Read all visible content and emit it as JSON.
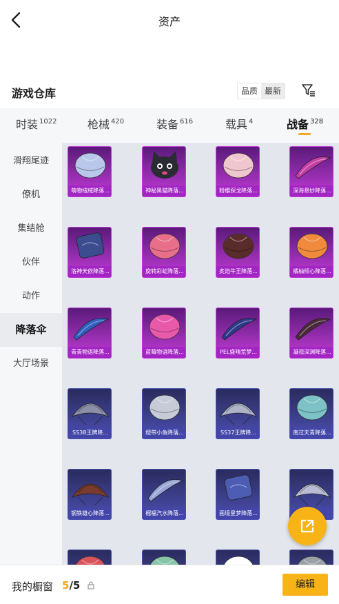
{
  "header": {
    "title": "资产"
  },
  "warehouse": {
    "title": "游戏仓库",
    "sort_options": [
      "品质",
      "最新"
    ],
    "active_sort": "品质"
  },
  "tabs": [
    {
      "label": "时装",
      "count": "1022"
    },
    {
      "label": "枪械",
      "count": "420"
    },
    {
      "label": "装备",
      "count": "616"
    },
    {
      "label": "载具",
      "count": "4"
    },
    {
      "label": "战备",
      "count": "328",
      "active": true
    }
  ],
  "sidebar": {
    "items": [
      {
        "label": "滑翔尾迹"
      },
      {
        "label": "僚机"
      },
      {
        "label": "集结舱"
      },
      {
        "label": "伙伴"
      },
      {
        "label": "动作"
      },
      {
        "label": "降落伞",
        "active": true
      },
      {
        "label": "大厅场景"
      }
    ]
  },
  "items": [
    {
      "name": "萌物绒绒降落...",
      "tier": "purple",
      "color": "#b9c8ea",
      "shape": "dome"
    },
    {
      "name": "神秘黑猫降落...",
      "tier": "purple",
      "color": "#2b2b33",
      "shape": "cat"
    },
    {
      "name": "粉樱探戈降落...",
      "tier": "purple",
      "color": "#f1c7cf",
      "shape": "dome"
    },
    {
      "name": "深海悬妙降落...",
      "tier": "purple",
      "color": "#c63fa6",
      "shape": "wing"
    },
    {
      "name": "洛神天依降落...",
      "tier": "purple",
      "color": "#3b4c8f",
      "shape": "square"
    },
    {
      "name": "旋转彩虹降落...",
      "tier": "purple",
      "color": "#e76f8a",
      "shape": "dome"
    },
    {
      "name": "炙焰牛王降落...",
      "tier": "purple",
      "color": "#5a2b2b",
      "shape": "dome"
    },
    {
      "name": "橘柚倾心降落...",
      "tier": "purple",
      "color": "#f08a3c",
      "shape": "dome"
    },
    {
      "name": "青青物语降落...",
      "tier": "purple",
      "color": "#2f5fbf",
      "shape": "wing"
    },
    {
      "name": "蓝莓物语降落...",
      "tier": "purple",
      "color": "#e85aa9",
      "shape": "dome"
    },
    {
      "name": "PEL盛晴荒梦...",
      "tier": "purple",
      "color": "#2d3a8a",
      "shape": "wing"
    },
    {
      "name": "凝视深渊降落...",
      "tier": "purple",
      "color": "#4a2a3a",
      "shape": "wing"
    },
    {
      "name": "SS38王牌降...",
      "tier": "blue",
      "color": "#8b8fa8",
      "shape": "curved"
    },
    {
      "name": "绶带小鱼降落...",
      "tier": "blue",
      "color": "#c6cbd8",
      "shape": "dome"
    },
    {
      "name": "SS37王牌降...",
      "tier": "blue",
      "color": "#aeb3c8",
      "shape": "curved"
    },
    {
      "name": "南过天青降落...",
      "tier": "blue",
      "color": "#7cc2c6",
      "shape": "dome"
    },
    {
      "name": "钢铁雄心降落...",
      "tier": "blue",
      "color": "#7a3b2e",
      "shape": "curved"
    },
    {
      "name": "榴福汽水降落...",
      "tier": "blue",
      "color": "#9aa7d6",
      "shape": "wing"
    },
    {
      "name": "画境星梦降落...",
      "tier": "blue",
      "color": "#4c5db3",
      "shape": "square"
    },
    {
      "name": "",
      "tier": "blue",
      "color": "#b7bcd2",
      "shape": "curved"
    },
    {
      "name": "",
      "tier": "blue",
      "color": "#d9535b",
      "shape": "dome"
    },
    {
      "name": "",
      "tier": "blue",
      "color": "#88c4a8",
      "shape": "dome"
    },
    {
      "name": "",
      "tier": "blue",
      "color": "#ffffff",
      "shape": "dome"
    },
    {
      "name": "",
      "tier": "blue",
      "color": "#9aa0a6",
      "shape": "dome"
    }
  ],
  "showcase": {
    "label": "我的橱窗",
    "current": "5",
    "total": "/5"
  },
  "actions": {
    "edit_label": "编辑"
  },
  "colors": {
    "accent": "#f8b416",
    "purple_tier": "#8e2bb0",
    "blue_tier": "#3c3f8f"
  }
}
